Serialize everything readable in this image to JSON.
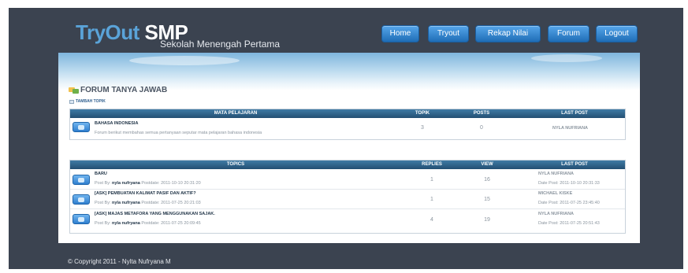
{
  "header": {
    "logo_main": "TryOut",
    "logo_accent": "SMP",
    "logo_sub": "Sekolah Menengah Pertama"
  },
  "nav": {
    "items": [
      {
        "label": "Home"
      },
      {
        "label": "Tryout"
      },
      {
        "label": "Rekap Nilai"
      },
      {
        "label": "Forum"
      },
      {
        "label": "Logout"
      }
    ]
  },
  "page": {
    "title": "FORUM TANYA JAWAB",
    "add_topic": "TAMBAH TOPIK"
  },
  "subjects_table": {
    "headers": [
      "MATA PELAJARAN",
      "TOPIK",
      "POSTS",
      "LAST POST"
    ],
    "rows": [
      {
        "name": "BAHASA INDONESIA",
        "description": "Forum berikut membahas semua pertanyaan seputar mata pelajaran bahasa indonesia",
        "topics": "3",
        "posts": "0",
        "last_post": "NYLA NUFRIANA"
      }
    ]
  },
  "topics_table": {
    "headers": [
      "TOPICS",
      "REPLIES",
      "VIEW",
      "LAST POST"
    ],
    "rows": [
      {
        "title": "BARU",
        "by_prefix": "Post By:",
        "by_user": "nyla nufryana",
        "postdate": "Postdate: 2011-10-10 20:31:20",
        "replies": "1",
        "views": "16",
        "last_user": "NYLA NUFRIANA",
        "last_date": "Date Post: 2011-10-10 20:31:33"
      },
      {
        "title": "[ASK] PEMBUATAN KALIMAT PASIF DAN AKTIF?",
        "by_prefix": "Post By:",
        "by_user": "nyla nufryana",
        "postdate": "Postdate: 2011-07-25 20:21:03",
        "replies": "1",
        "views": "15",
        "last_user": "MICHAEL KISKE",
        "last_date": "Date Post: 2011-07-25 23:45:40"
      },
      {
        "title": "[ASK] MAJAS METAFORA YANG MENGGUNAKAN SAJAK.",
        "by_prefix": "Post By:",
        "by_user": "nyla nufryana",
        "postdate": "Postdate: 2011-07-25 20:09:45",
        "replies": "4",
        "views": "19",
        "last_user": "NYLA NUFRIANA",
        "last_date": "Date Post: 2011-07-25 20:51:43"
      }
    ]
  },
  "footer": {
    "copyright": "© Copyright 2011 - Nylta Nufryana M"
  }
}
